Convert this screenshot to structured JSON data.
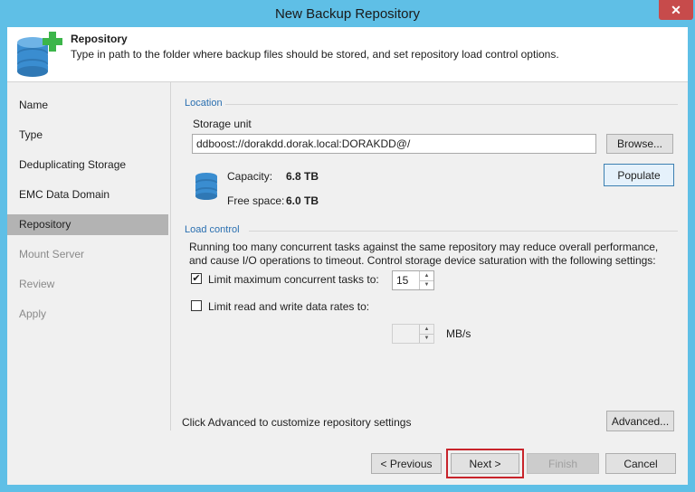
{
  "window": {
    "title": "New Backup Repository",
    "close_glyph": "✕"
  },
  "header": {
    "title": "Repository",
    "description": "Type in path to the folder where backup files should be stored, and set repository load control options.",
    "icon": "database-add-icon"
  },
  "nav": {
    "items": [
      {
        "label": "Name",
        "state": "normal"
      },
      {
        "label": "Type",
        "state": "normal"
      },
      {
        "label": "Deduplicating Storage",
        "state": "normal"
      },
      {
        "label": "EMC Data Domain",
        "state": "normal"
      },
      {
        "label": "Repository",
        "state": "active"
      },
      {
        "label": "Mount Server",
        "state": "disabled"
      },
      {
        "label": "Review",
        "state": "disabled"
      },
      {
        "label": "Apply",
        "state": "disabled"
      }
    ]
  },
  "location": {
    "section_label": "Location",
    "storage_unit_label": "Storage unit",
    "storage_unit_value": "ddboost://dorakdd.dorak.local:DORAKDD@/",
    "browse_label": "Browse...",
    "populate_label": "Populate",
    "capacity_label": "Capacity:",
    "capacity_value": "6.8 TB",
    "free_space_label": "Free space:",
    "free_space_value": "6.0 TB"
  },
  "load_control": {
    "section_label": "Load control",
    "description_line1": "Running too many concurrent tasks against the same repository may reduce overall performance,",
    "description_line2": "and cause I/O operations to timeout. Control storage device saturation with the following settings:",
    "limit_tasks_label": "Limit maximum concurrent tasks to:",
    "limit_tasks_checked": true,
    "limit_tasks_value": "15",
    "limit_rate_label": "Limit read and write data rates to:",
    "limit_rate_checked": false,
    "limit_rate_value": "",
    "rate_unit": "MB/s",
    "check_glyph": "✔"
  },
  "advanced": {
    "text": "Click Advanced to customize repository settings",
    "button_label": "Advanced..."
  },
  "footer": {
    "previous_label": "< Previous",
    "next_label": "Next >",
    "finish_label": "Finish",
    "cancel_label": "Cancel"
  },
  "colors": {
    "accent": "#2a6fb0",
    "titlebar": "#5fbfe6",
    "highlight": "#c8242b",
    "active_nav": "#b3b3b3"
  }
}
